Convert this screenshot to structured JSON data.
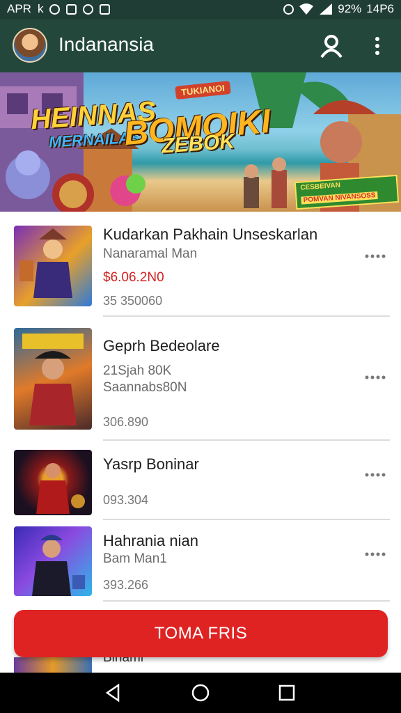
{
  "status_bar": {
    "carrier": "APR",
    "notification_glyph": "k",
    "battery_percent": "92%",
    "time": "14P6",
    "icons": [
      "circle-notification-icon",
      "app-notification-icon",
      "refresh-notification-icon",
      "image-notification-icon",
      "alarm-icon",
      "wifi-icon",
      "signal-icon"
    ]
  },
  "app_bar": {
    "title": "Indanansia",
    "icons": [
      "avatar",
      "account-icon",
      "overflow-menu-icon"
    ]
  },
  "banner": {
    "ribbon": "TUKIANOI",
    "headline_1": "HEINNAS",
    "headline_2": "MERNAILAS",
    "headline_3": "BOMOIKI",
    "headline_4": "ZEBOK",
    "badge_line_1": "CESBEIVAN",
    "badge_line_2": "POMVAN NIVANSOSS",
    "colors": {
      "headline": "#ffd23a",
      "subhead": "#3fb6ff",
      "badge": "#2f8a2f"
    }
  },
  "games": [
    {
      "title": "Kudarkan Pakhain Unseskarlan",
      "subtitle": "Nanaramal Man",
      "price": "$6.06.2N0",
      "meta": "35 350060"
    },
    {
      "title": "Geprh Bedeolare",
      "subtitle": "21Sjah 80K",
      "subtitle_2": "Saannabs80N",
      "meta": "306.890"
    },
    {
      "title": "Yasrp Boninar",
      "meta": "093.304"
    },
    {
      "title": "Hahrania nian",
      "subtitle": "Bam Man1",
      "meta": "393.266"
    }
  ],
  "partial_item": {
    "title": "Blnami"
  },
  "cta": {
    "label": "TOMA FRIS",
    "color": "#df2323"
  },
  "nav_bar": {
    "icons": [
      "back-icon",
      "home-icon",
      "recents-icon"
    ]
  }
}
